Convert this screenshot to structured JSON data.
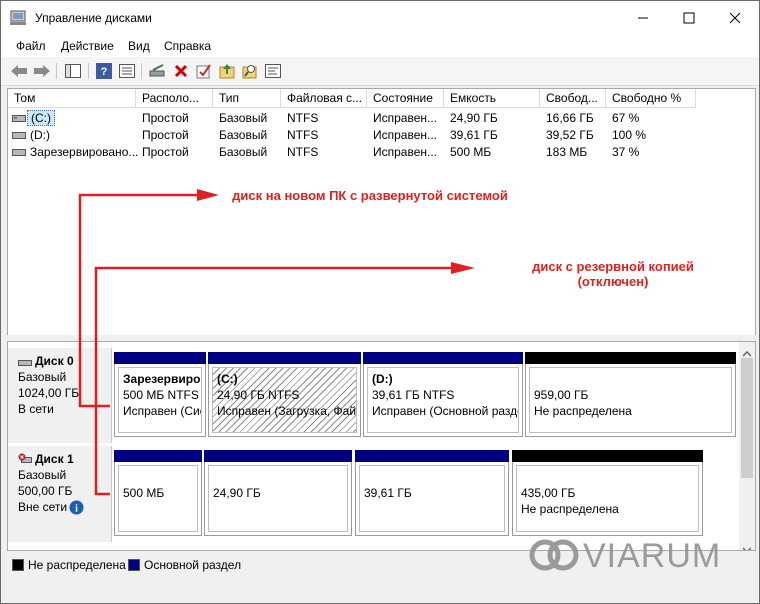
{
  "window": {
    "title": "Управление дисками"
  },
  "menu": [
    "Файл",
    "Действие",
    "Вид",
    "Справка"
  ],
  "toolbar_icons": [
    "back-arrow-icon",
    "forward-arrow-icon",
    "console-tree-icon",
    "help-icon",
    "properties-icon",
    "connect-disk-icon",
    "delete-icon",
    "check-icon",
    "import-icon",
    "search-icon",
    "list-icon"
  ],
  "volume_table": {
    "headers": [
      "Том",
      "Располо...",
      "Тип",
      "Файловая с...",
      "Состояние",
      "Емкость",
      "Свобод...",
      "Свободно %"
    ],
    "rows": [
      [
        "(C:)",
        "Простой",
        "Базовый",
        "NTFS",
        "Исправен...",
        "24,90 ГБ",
        "16,66 ГБ",
        "67 %"
      ],
      [
        "(D:)",
        "Простой",
        "Базовый",
        "NTFS",
        "Исправен...",
        "39,61 ГБ",
        "39,52 ГБ",
        "100 %"
      ],
      [
        "Зарезервировано...",
        "Простой",
        "Базовый",
        "NTFS",
        "Исправен...",
        "500 МБ",
        "183 МБ",
        "37 %"
      ]
    ]
  },
  "annotations": {
    "first": "диск на новом ПК с развернутой системой",
    "second": "диск с резервной копией (отключен)"
  },
  "disks": [
    {
      "name": "Диск 0",
      "type": "Базовый",
      "size": "1024,00 ГБ",
      "status": "В сети",
      "partitions": [
        {
          "title": "Зарезервиро",
          "size": "500 МБ NTFS",
          "state": "Исправен (Сис"
        },
        {
          "title": "(C:)",
          "size": "24,90 ГБ NTFS",
          "state": "Исправен (Загрузка, Фай."
        },
        {
          "title": "(D:)",
          "size": "39,61 ГБ NTFS",
          "state": "Исправен (Основной разде"
        },
        {
          "title": "",
          "size": "959,00 ГБ",
          "state": "Не распределена"
        }
      ]
    },
    {
      "name": "Диск 1",
      "type": "Базовый",
      "size": "500,00 ГБ",
      "status": "Вне сети",
      "partitions": [
        {
          "size": "500 МБ",
          "state": ""
        },
        {
          "size": "24,90 ГБ",
          "state": ""
        },
        {
          "size": "39,61 ГБ",
          "state": ""
        },
        {
          "size": "435,00 ГБ",
          "state": "Не распределена"
        }
      ]
    }
  ],
  "legend": {
    "unallocated": "Не распределена",
    "primary": "Основной раздел"
  },
  "watermark": "VIARUM",
  "colors": {
    "primary_partition": "#000080",
    "unallocated": "#000000",
    "annotation": "#e02020",
    "info": "#1a5fb4"
  }
}
